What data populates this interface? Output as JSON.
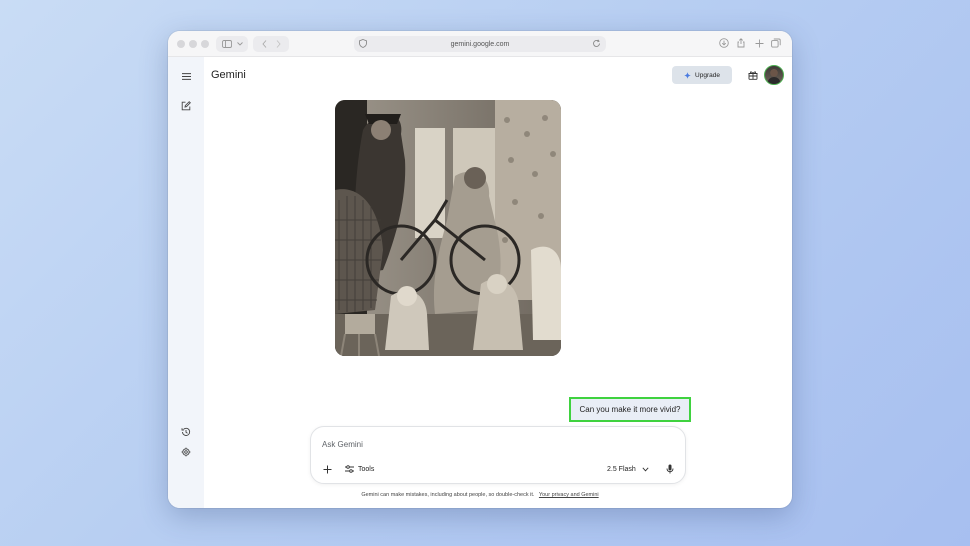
{
  "browser": {
    "url": "gemini.google.com",
    "icons": [
      "sidebar-toggle-icon",
      "chevron-down-icon",
      "back-icon",
      "forward-icon",
      "shield-icon",
      "reload-icon",
      "download-icon",
      "share-icon",
      "new-tab-icon",
      "tabs-overview-icon"
    ]
  },
  "app": {
    "title": "Gemini",
    "upgrade_label": "Upgrade",
    "sidebar_icons": [
      "menu-icon",
      "new-chat-icon",
      "history-icon",
      "settings-icon"
    ]
  },
  "conversation": {
    "image": {
      "description_icon": "image"
    },
    "user_message": "Can you make it more vivid?"
  },
  "composer": {
    "placeholder": "Ask Gemini",
    "tools_label": "Tools",
    "model_label": "2.5 Flash"
  },
  "footer": {
    "disclaimer": "Gemini can make mistakes, including about people, so double-check it.",
    "privacy_link": "Your privacy and Gemini"
  },
  "colors": {
    "highlight": "#3fd23f",
    "sidebar_bg": "#f2f5fa",
    "upgrade_bg": "#dde3ea"
  }
}
